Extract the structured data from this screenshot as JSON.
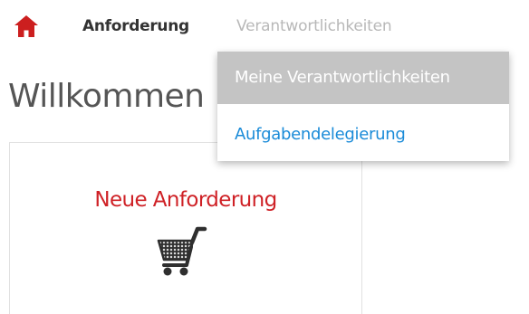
{
  "nav": {
    "home_icon": "home-icon",
    "requests_label": "Anforderung",
    "responsibilities_label": "Verantwortlichkeiten"
  },
  "welcome_title": "Willkommen",
  "tile": {
    "title": "Neue Anforderung",
    "icon": "shopping-cart-icon"
  },
  "dropdown": {
    "items": [
      {
        "label": "Meine Verantwortlichkeiten",
        "state": "hovered"
      },
      {
        "label": "Aufgabendelegierung"
      }
    ]
  },
  "colors": {
    "brand_red": "#cf2126",
    "link_blue": "#1a8bd8",
    "muted_nav": "#b8b8b8",
    "hover_bg": "#c4c4c4"
  }
}
